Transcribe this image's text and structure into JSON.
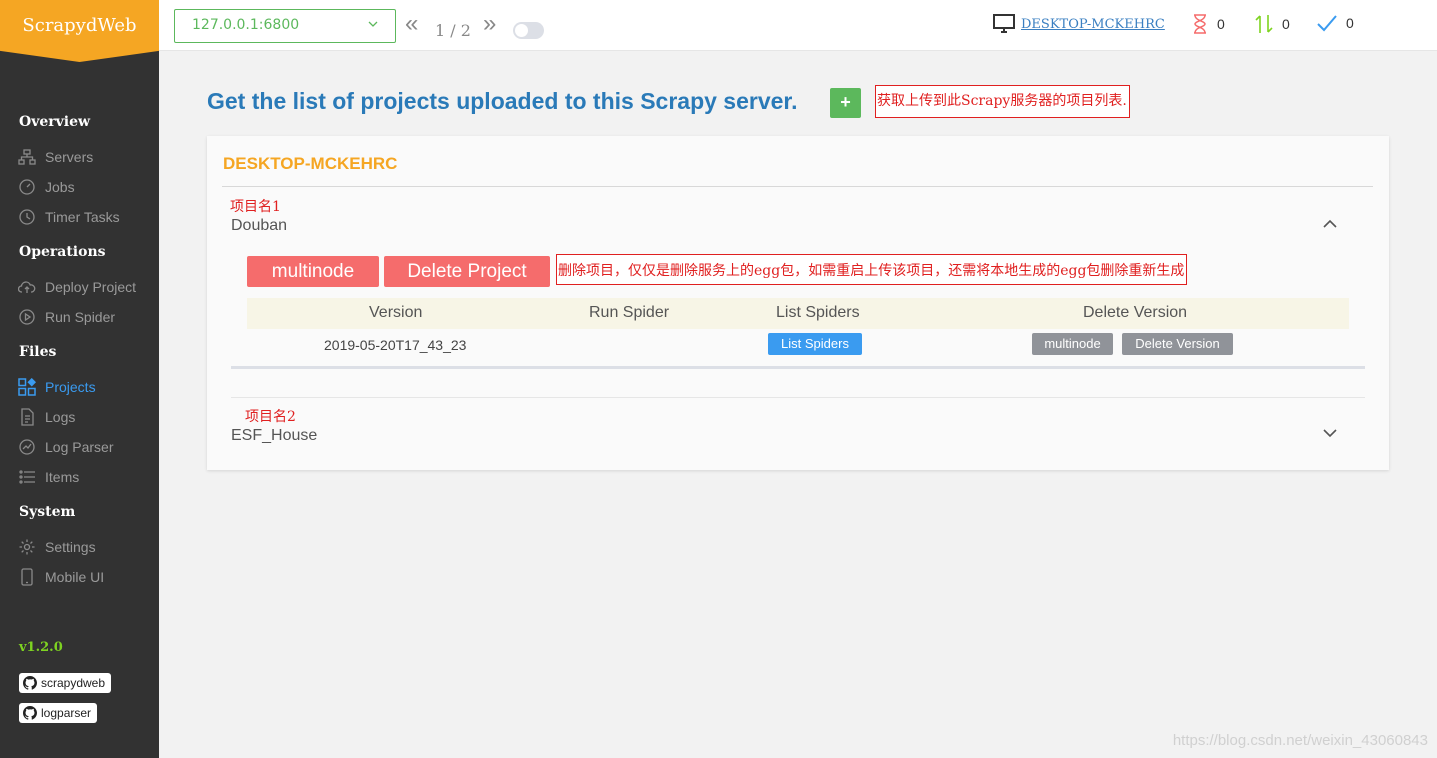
{
  "app": {
    "logo": "ScrapydWeb",
    "version": "v1.2.0"
  },
  "sidebar": {
    "sections": [
      {
        "title": "Overview",
        "items": [
          {
            "label": "Servers",
            "icon": "servers-icon"
          },
          {
            "label": "Jobs",
            "icon": "gauge-icon"
          },
          {
            "label": "Timer Tasks",
            "icon": "clock-icon"
          }
        ]
      },
      {
        "title": "Operations",
        "items": [
          {
            "label": "Deploy Project",
            "icon": "cloud-upload-icon"
          },
          {
            "label": "Run Spider",
            "icon": "play-icon"
          }
        ]
      },
      {
        "title": "Files",
        "items": [
          {
            "label": "Projects",
            "icon": "projects-icon",
            "active": true
          },
          {
            "label": "Logs",
            "icon": "document-icon"
          },
          {
            "label": "Log Parser",
            "icon": "stats-icon"
          },
          {
            "label": "Items",
            "icon": "list-icon"
          }
        ]
      },
      {
        "title": "System",
        "items": [
          {
            "label": "Settings",
            "icon": "gear-icon"
          },
          {
            "label": "Mobile UI",
            "icon": "mobile-icon"
          }
        ]
      }
    ],
    "github_links": [
      "scrapydweb",
      "logparser"
    ]
  },
  "topbar": {
    "server": "127.0.0.1:6800",
    "pager": {
      "prev": "«",
      "text": "1 / 2",
      "next": "»"
    },
    "host": "DESKTOP-MCKEHRC",
    "stats": {
      "pending": "0",
      "running": "0",
      "finished": "0"
    }
  },
  "main": {
    "heading": "Get the list of projects uploaded to this Scrapy server.",
    "add_label": "+",
    "note_heading": "获取上传到此Scrapy服务器的项目列表.",
    "card_title": "DESKTOP-MCKEHRC",
    "projects": [
      {
        "tag": "项目名1",
        "name": "Douban",
        "expanded": true
      },
      {
        "tag": "项目名2",
        "name": "ESF_House",
        "expanded": false
      }
    ],
    "buttons": {
      "multinode": "multinode",
      "delete_project": "Delete Project"
    },
    "note_delete": "删除项目，仅仅是删除服务上的egg包，如需重启上传该项目，还需将本地生成的egg包删除重新生成",
    "table": {
      "headers": [
        "Version",
        "Run Spider",
        "List Spiders",
        "Delete Version"
      ],
      "rows": [
        {
          "version": "2019-05-20T17_43_23",
          "list_spiders": "List Spiders",
          "multinode": "multinode",
          "delete_version": "Delete Version"
        }
      ]
    }
  },
  "watermark": "https://blog.csdn.net/weixin_43060843",
  "colors": {
    "accent": "#f5a623",
    "primary": "#3a9bf0",
    "danger": "#f56c6c",
    "success": "#5cb85c",
    "sidebar": "#323232"
  }
}
